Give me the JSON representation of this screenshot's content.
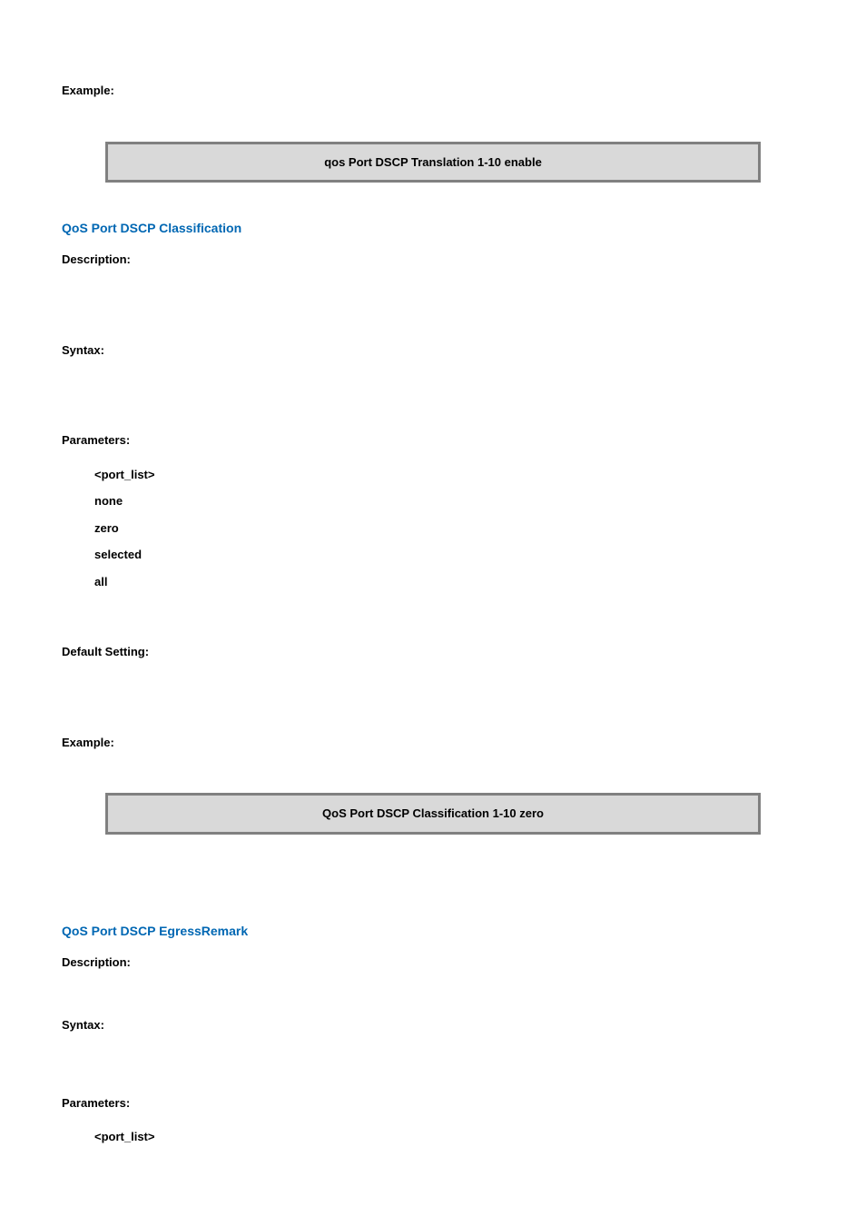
{
  "example_label": "Example:",
  "code_box_1": "qos Port DSCP Translation 1-10 enable",
  "section1": {
    "title": "QoS Port DSCP Classification",
    "description_label": "Description:",
    "syntax_label": "Syntax:",
    "parameters_label": "Parameters:",
    "params": {
      "p1": "<port_list>",
      "p2": "none",
      "p3": "zero",
      "p4": "selected",
      "p5": "all"
    },
    "default_setting_label": "Default Setting:",
    "example_label": "Example:",
    "code_box": "QoS Port DSCP Classification 1-10 zero"
  },
  "section2": {
    "title": "QoS Port DSCP EgressRemark",
    "description_label": "Description:",
    "syntax_label": "Syntax:",
    "parameters_label": "Parameters:",
    "params": {
      "p1": "<port_list>"
    }
  }
}
